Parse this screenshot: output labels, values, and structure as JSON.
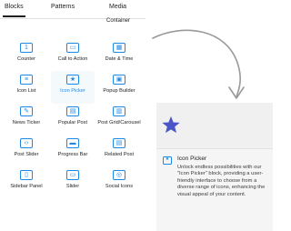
{
  "tabs": [
    {
      "label": "Blocks",
      "active": true
    },
    {
      "label": "Patterns",
      "active": false
    },
    {
      "label": "Media",
      "active": false
    }
  ],
  "cut_label": "Container",
  "accent_color": "#1e88e5",
  "blocks": [
    {
      "label": "Counter",
      "icon": "counter-icon",
      "glyph": "1"
    },
    {
      "label": "Call to Action",
      "icon": "call-to-action-icon",
      "glyph": "▭"
    },
    {
      "label": "Date & Time",
      "icon": "date-time-icon",
      "glyph": "▦"
    },
    {
      "label": "Icon List",
      "icon": "icon-list-icon",
      "glyph": "≡"
    },
    {
      "label": "Icon Picker",
      "icon": "icon-picker-icon",
      "glyph": "★",
      "selected": true
    },
    {
      "label": "Popup Builder",
      "icon": "popup-builder-icon",
      "glyph": "▣"
    },
    {
      "label": "News Ticker",
      "icon": "news-ticker-icon",
      "glyph": "✎"
    },
    {
      "label": "Popular Post",
      "icon": "popular-post-icon",
      "glyph": "▤"
    },
    {
      "label": "Post Grid/Carousel",
      "icon": "post-grid-carousel-icon",
      "glyph": "▥"
    },
    {
      "label": "Post Slider",
      "icon": "post-slider-icon",
      "glyph": "‹›"
    },
    {
      "label": "Progress Bar",
      "icon": "progress-bar-icon",
      "glyph": "▬"
    },
    {
      "label": "Related Post",
      "icon": "related-post-icon",
      "glyph": "▤"
    },
    {
      "label": "Sidebar Panel",
      "icon": "sidebar-panel-icon",
      "glyph": "▯"
    },
    {
      "label": "Slider",
      "icon": "slider-icon",
      "glyph": "▭"
    },
    {
      "label": "Social Icons",
      "icon": "social-icons-icon",
      "glyph": "◎"
    }
  ],
  "preview": {
    "title": "Icon Picker",
    "icon": "icon-picker-icon",
    "star_icon": "star-icon",
    "description": "Unlock endless possibilities with our \"Icon Picker\" block, providing a user-friendly interface to choose from a diverse range of icons, enhancing the visual appeal of your content."
  }
}
